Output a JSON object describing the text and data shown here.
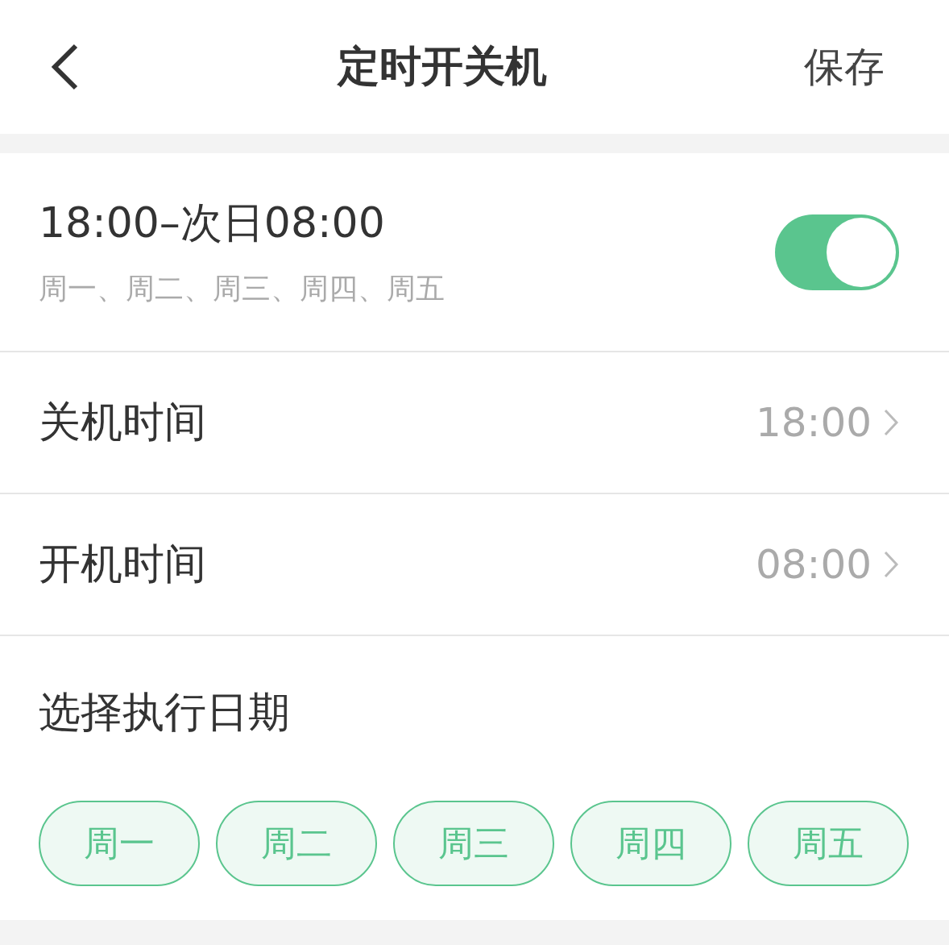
{
  "header": {
    "title": "定时开关机",
    "action": "保存"
  },
  "schedule": {
    "time_range": "18:00–次日08:00",
    "days": "周一、周二、周三、周四、周五",
    "on": true
  },
  "rows": [
    {
      "label": "关机时间",
      "value": "18:00"
    },
    {
      "label": "开机时间",
      "value": "08:00"
    }
  ],
  "day_picker": {
    "title": "选择执行日期",
    "days": [
      {
        "label": "周一",
        "selected": true
      },
      {
        "label": "周二",
        "selected": true
      },
      {
        "label": "周三",
        "selected": true
      },
      {
        "label": "周四",
        "selected": true
      },
      {
        "label": "周五",
        "selected": true
      }
    ]
  }
}
